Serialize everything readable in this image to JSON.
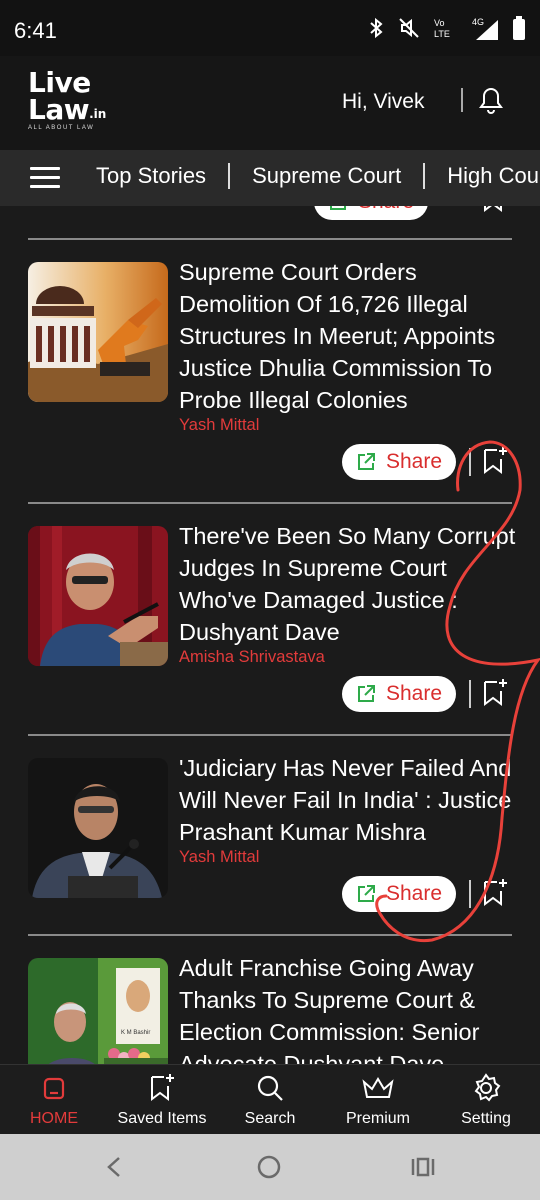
{
  "status": {
    "time": "6:41"
  },
  "header": {
    "logo_line1": "Live",
    "logo_line2": "Law",
    "logo_suffix": ".in",
    "logo_tagline": "ALL ABOUT LAW",
    "greeting": "Hi, Vivek"
  },
  "nav": {
    "tabs": [
      "Top Stories",
      "Supreme Court",
      "High Court"
    ]
  },
  "articles": [
    {
      "headline": "Supreme Court Orders Demolition Of 16,726 Illegal Structures In Meerut; Appoints Justice Dhulia Commission To Probe Illegal Colonies",
      "author": "Yash Mittal",
      "share": "Share"
    },
    {
      "headline": "There've Been So Many Corrupt Judges In Supreme Court Who've Damaged Justice : Dushyant Dave",
      "author": "Amisha Shrivastava",
      "share": "Share"
    },
    {
      "headline": "'Judiciary Has Never Failed And Will Never Fail In India' : Justice Prashant Kumar Mishra",
      "author": "Yash Mittal",
      "share": "Share"
    },
    {
      "headline": "Adult Franchise Going Away Thanks To Supreme Court & Election Commission: Senior Advocate Dushyant Dave",
      "thumb_caption": "K M Bashir"
    }
  ],
  "partial_share": "Share",
  "bottom_nav": {
    "home": "HOME",
    "saved": "Saved Items",
    "search": "Search",
    "premium": "Premium",
    "setting": "Setting"
  },
  "colors": {
    "accent_red": "#e23b3b",
    "share_icon_green": "#2eaa4a",
    "background": "#1b1b1b"
  }
}
